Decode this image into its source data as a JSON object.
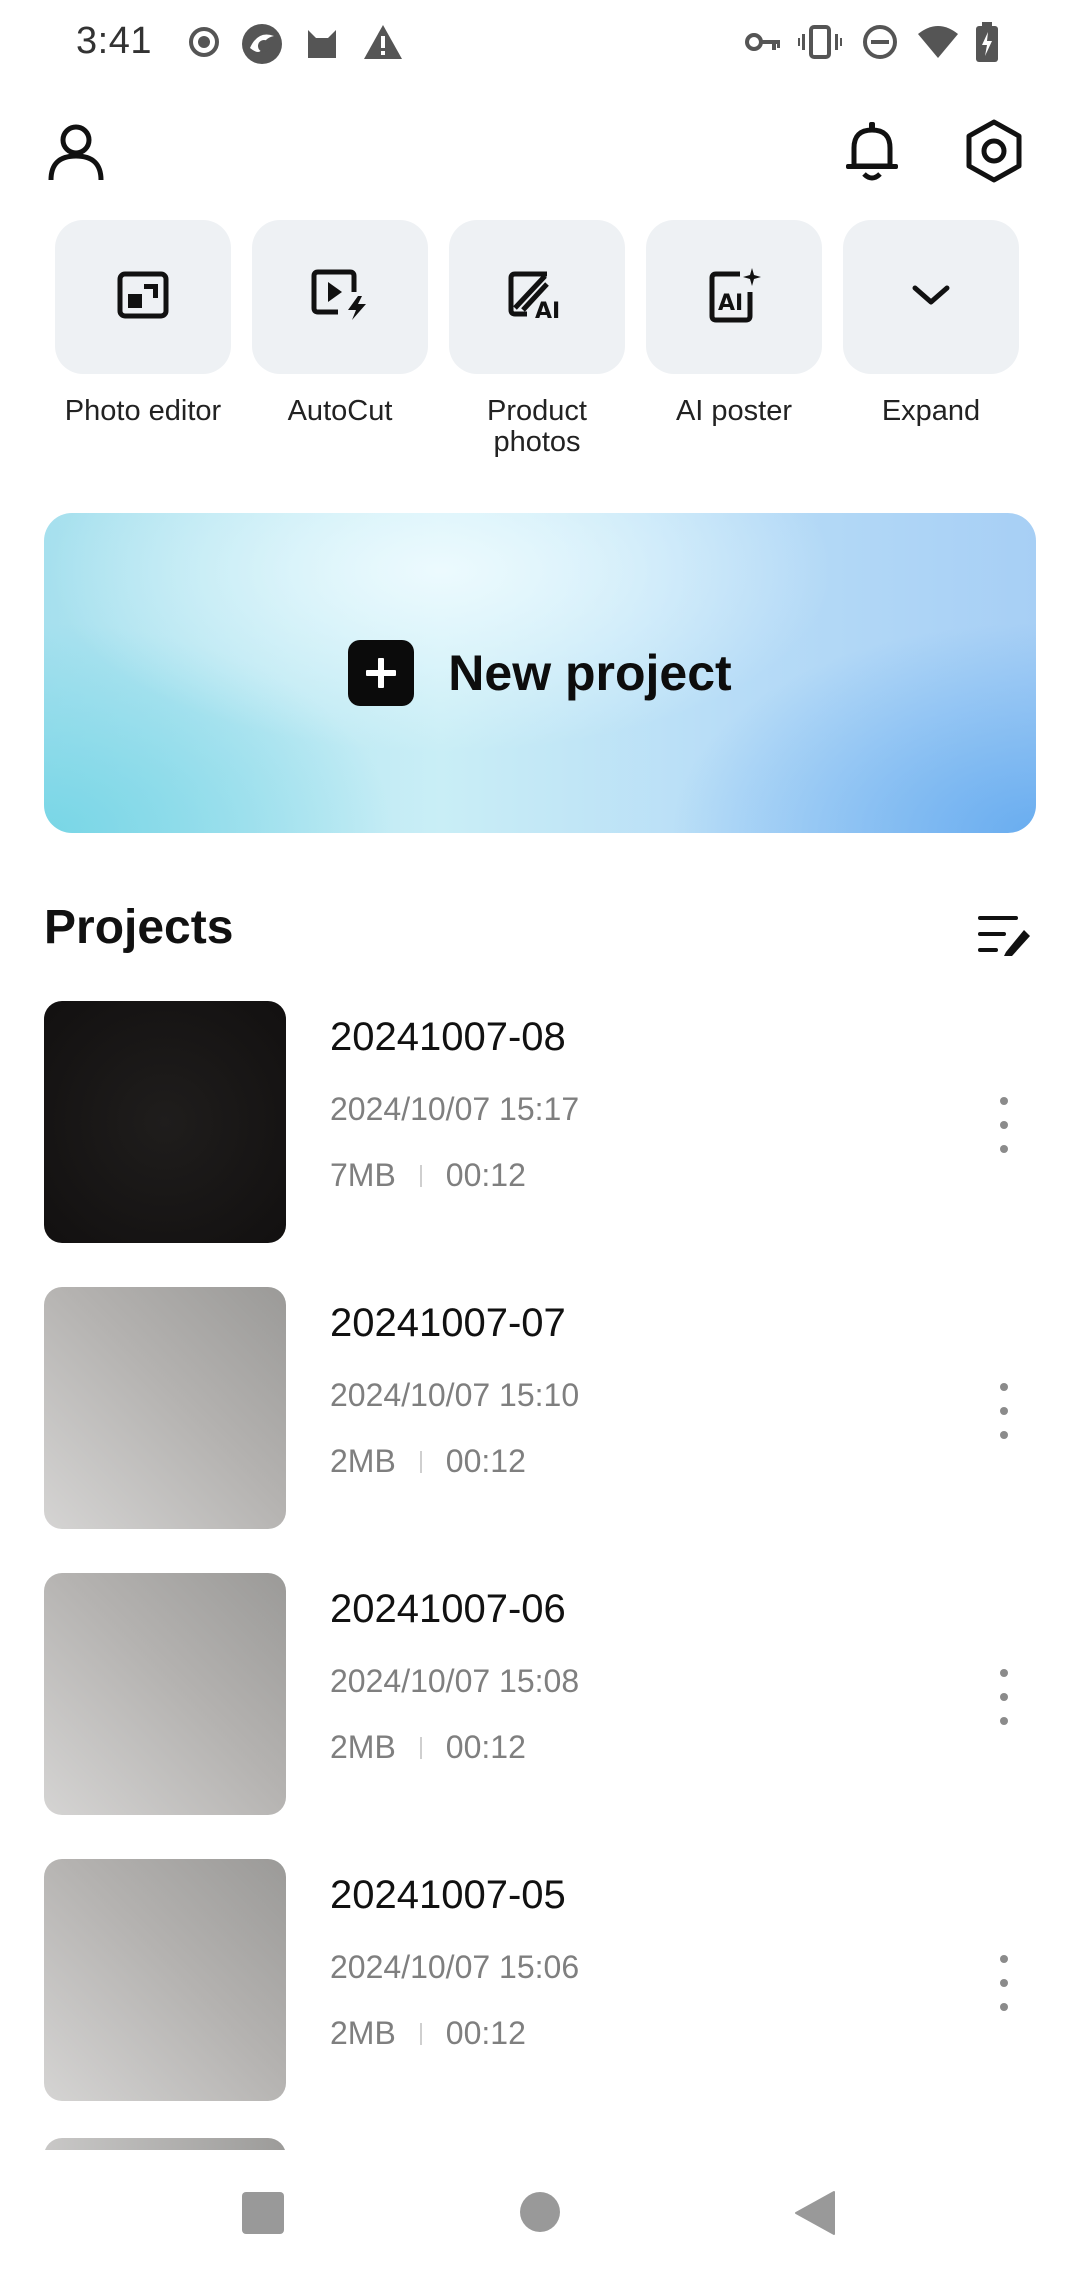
{
  "status_bar": {
    "time": "3:41",
    "left_icons": [
      "record-icon",
      "browser-icon",
      "cat-icon",
      "warning-icon"
    ],
    "right_icons": [
      "vpn-key-icon",
      "vibrate-icon",
      "dnd-icon",
      "wifi-icon",
      "battery-charging-icon"
    ]
  },
  "header": {
    "profile_icon": "profile-icon",
    "notification_icon": "bell-icon",
    "settings_icon": "settings-icon"
  },
  "tools": [
    {
      "label": "Photo editor",
      "icon": "photo-editor-icon"
    },
    {
      "label": "AutoCut",
      "icon": "autocut-icon"
    },
    {
      "label": "Product\nphotos",
      "icon": "product-photos-icon"
    },
    {
      "label": "AI poster",
      "icon": "ai-poster-icon"
    },
    {
      "label": "Expand",
      "icon": "chevron-down-icon"
    }
  ],
  "banner": {
    "label": "New project",
    "icon": "plus-icon"
  },
  "projects": {
    "title": "Projects",
    "edit_icon": "list-edit-icon",
    "items": [
      {
        "name": "20241007-08",
        "date": "2024/10/07 15:17",
        "size": "7MB",
        "duration": "00:12",
        "thumb": "dark"
      },
      {
        "name": "20241007-07",
        "date": "2024/10/07 15:10",
        "size": "2MB",
        "duration": "00:12",
        "thumb": "gray"
      },
      {
        "name": "20241007-06",
        "date": "2024/10/07 15:08",
        "size": "2MB",
        "duration": "00:12",
        "thumb": "gray"
      },
      {
        "name": "20241007-05",
        "date": "2024/10/07 15:06",
        "size": "2MB",
        "duration": "00:12",
        "thumb": "gray"
      }
    ]
  },
  "nav_bar": {
    "buttons": [
      "recents-square-icon",
      "home-circle-icon",
      "back-triangle-icon"
    ]
  }
}
